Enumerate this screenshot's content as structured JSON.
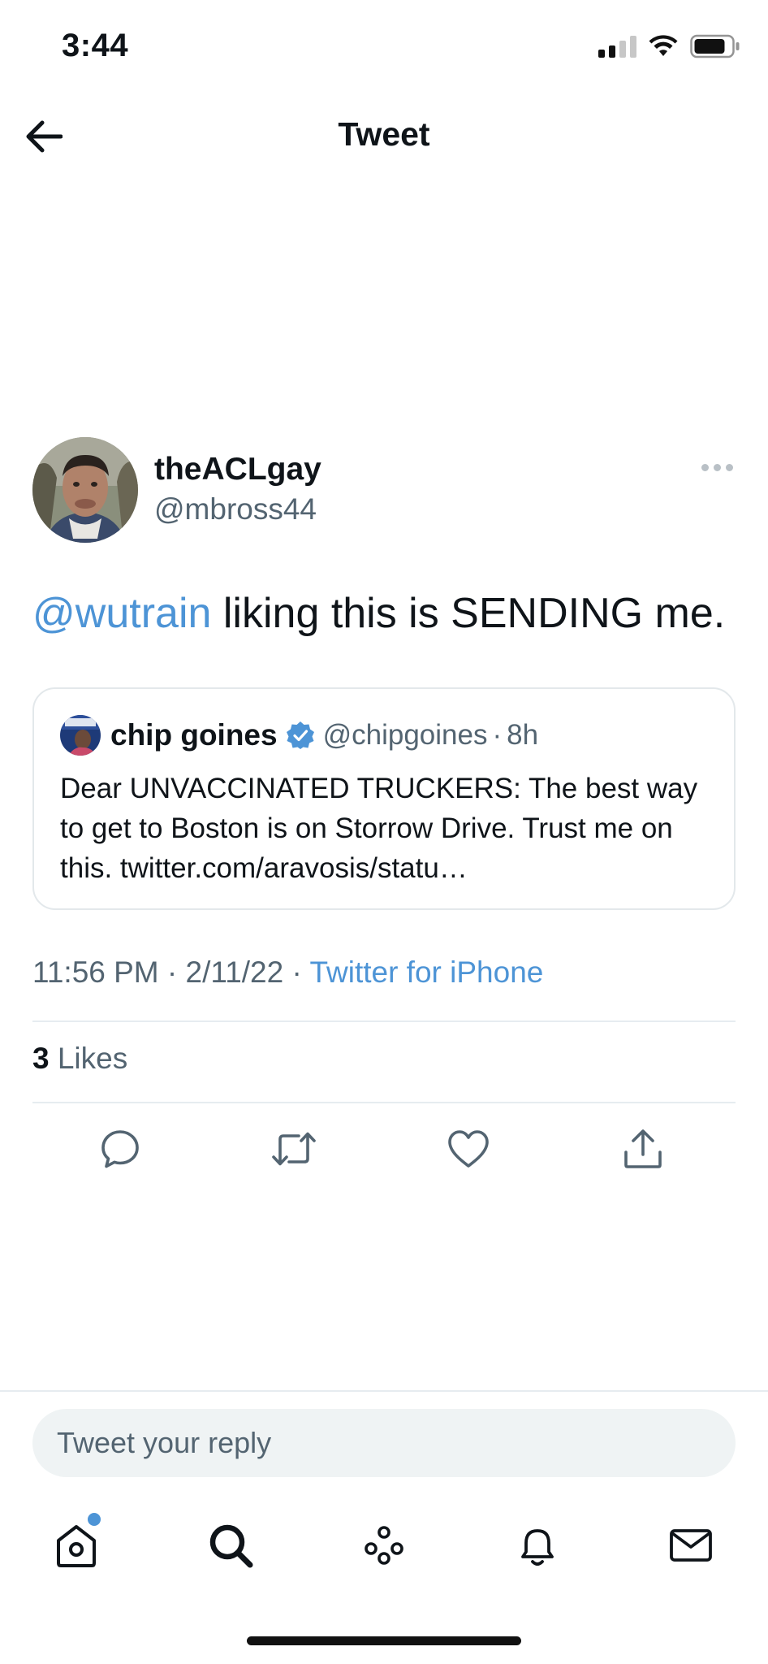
{
  "status_bar": {
    "time": "3:44"
  },
  "header": {
    "title": "Tweet"
  },
  "tweet": {
    "author": {
      "display_name": "theACLgay",
      "handle": "@mbross44"
    },
    "text": {
      "mention": "@wutrain",
      "body": " liking this is SENDING me."
    },
    "meta": {
      "time": "11:56 PM",
      "separator1": " · ",
      "date": "2/11/22",
      "separator2": " · ",
      "source": "Twitter for iPhone"
    },
    "likes": {
      "count": "3",
      "label": " Likes"
    }
  },
  "quoted_tweet": {
    "author": {
      "display_name": "chip goines",
      "handle": "@chipgoines",
      "verified": true
    },
    "dot": "·",
    "time": "8h",
    "text": "Dear UNVACCINATED TRUCKERS: The best way to get to Boston is on Storrow Drive. Trust me on this. twitter.com/aravosis/statu…"
  },
  "reply": {
    "placeholder": "Tweet your reply"
  },
  "tab_bar": {
    "items": [
      {
        "name": "home-icon",
        "has_badge": true
      },
      {
        "name": "search-icon"
      },
      {
        "name": "spaces-icon"
      },
      {
        "name": "notifications-icon"
      },
      {
        "name": "messages-icon"
      }
    ]
  },
  "colors": {
    "accent": "#4d94d6",
    "secondary_text": "#536471",
    "primary_text": "#0f1419",
    "divider": "#e6ecf0",
    "input_bg": "#eff3f4",
    "verified": "#4d94d6"
  }
}
